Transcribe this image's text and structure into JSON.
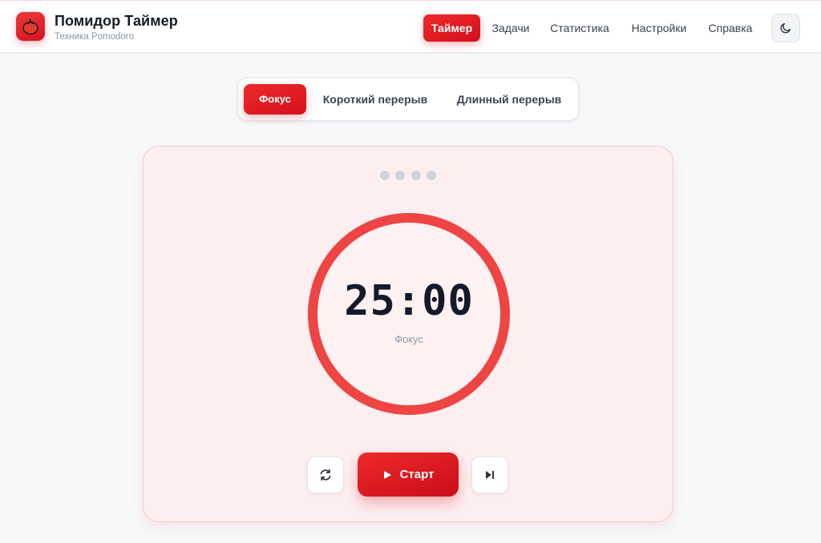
{
  "app": {
    "title": "Помидор Таймер",
    "subtitle": "Техника Pomodoro",
    "logo_icon": "tomato-icon"
  },
  "nav": {
    "items": [
      {
        "label": "Таймер",
        "active": true
      },
      {
        "label": "Задачи",
        "active": false
      },
      {
        "label": "Статистика",
        "active": false
      },
      {
        "label": "Настройки",
        "active": false
      },
      {
        "label": "Справка",
        "active": false
      }
    ],
    "theme_icon": "moon-icon"
  },
  "modes": [
    {
      "label": "Фокус",
      "active": true
    },
    {
      "label": "Короткий перерыв",
      "active": false
    },
    {
      "label": "Длинный перерыв",
      "active": false
    }
  ],
  "timer": {
    "time": "25:00",
    "label": "Фокус",
    "sessions_total": 4,
    "sessions_done": 0,
    "progress": 1.0
  },
  "controls": {
    "reset_icon": "reset-icon",
    "start_label": "Старт",
    "start_icon": "play-icon",
    "skip_icon": "skip-icon"
  },
  "colors": {
    "accent": "#e11d2a",
    "ring": "#ef4444",
    "card_bg": "#fdeff0"
  }
}
